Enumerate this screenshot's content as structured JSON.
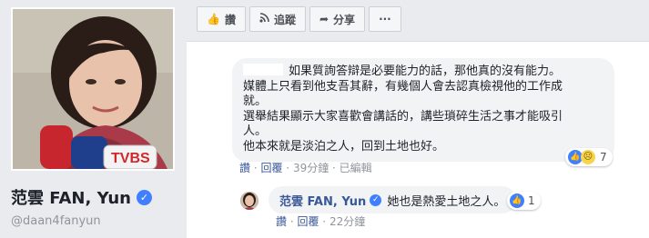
{
  "profile": {
    "name": "范雲 FAN, Yun",
    "handle": "@daan4fanyun",
    "photo_caption": "TVBS"
  },
  "action_bar": [
    {
      "icon": "thumbs-up-icon",
      "glyph": "👍",
      "label": "讚"
    },
    {
      "icon": "rss-icon",
      "glyph": "◎",
      "label": "追蹤"
    },
    {
      "icon": "share-icon",
      "glyph": "➦",
      "label": "分享"
    },
    {
      "icon": "more-icon",
      "glyph": "",
      "label": "···"
    }
  ],
  "comment": {
    "lines": [
      "如果質詢答辯是必要能力的話，那他真的沒有能力。",
      "媒體上只看到他支吾其辭，有幾個人會去認真檢視他的工作成",
      "就。",
      "選舉結果顯示大家喜歡會講話的，講些瑣碎生活之事才能吸引",
      "人。",
      "他本來就是淡泊之人，回到土地也好。"
    ],
    "reaction_count": "7",
    "actions": {
      "like": "讚",
      "sep1": " · ",
      "reply": "回覆",
      "sep2": " · ",
      "time": "39分鐘",
      "sep3": " · ",
      "edited": "已編輯"
    }
  },
  "reply": {
    "author": "范雲 FAN, Yun",
    "text": "她也是熱愛土地之人。",
    "reaction_count": "1",
    "actions": {
      "like": "讚",
      "sep1": " · ",
      "reply": "回覆",
      "sep2": " · ",
      "time": "22分鐘"
    }
  },
  "colors": {
    "link": "#385898",
    "meta": "#90949c",
    "like_blue": "#4080ff",
    "bubble": "#f2f3f5"
  }
}
